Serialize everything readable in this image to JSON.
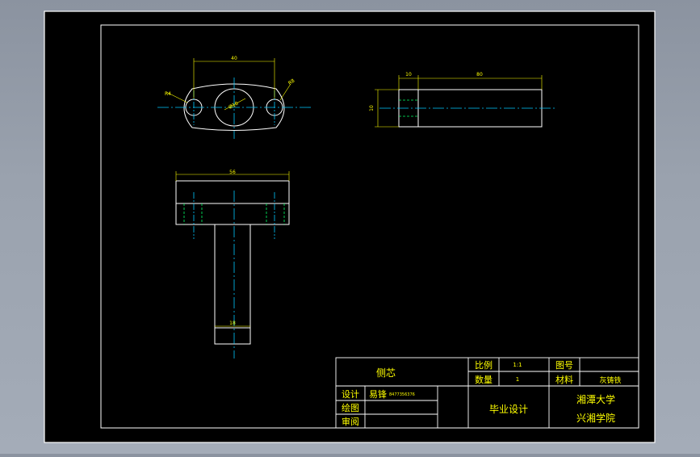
{
  "drawing": {
    "dimensions": {
      "top_width": "40",
      "top_dia_left": "R4",
      "top_dia_center": "Ø10",
      "top_dia_right": "R8",
      "side_offset": "10",
      "side_length": "80",
      "side_height": "10",
      "front_width": "56",
      "front_stem": "18"
    }
  },
  "title_block": {
    "part_name": "侧芯",
    "scale_label": "比例",
    "scale_value": "1:1",
    "quantity_label": "数量",
    "quantity_value": "1",
    "drawing_no_label": "图号",
    "material_label": "材料",
    "material_value": "灰铸铁",
    "design_label": "设计",
    "designer": "易锋",
    "contact": "8477356376",
    "draw_label": "绘图",
    "review_label": "审阅",
    "project": "毕业设计",
    "school_line1": "湘潭大学",
    "school_line2": "兴湘学院"
  },
  "colors": {
    "outline": "#ffffff",
    "dimension": "#ffff00",
    "centerline": "#00c8ff",
    "hidden": "#00ff66",
    "sheet": "#000000"
  }
}
